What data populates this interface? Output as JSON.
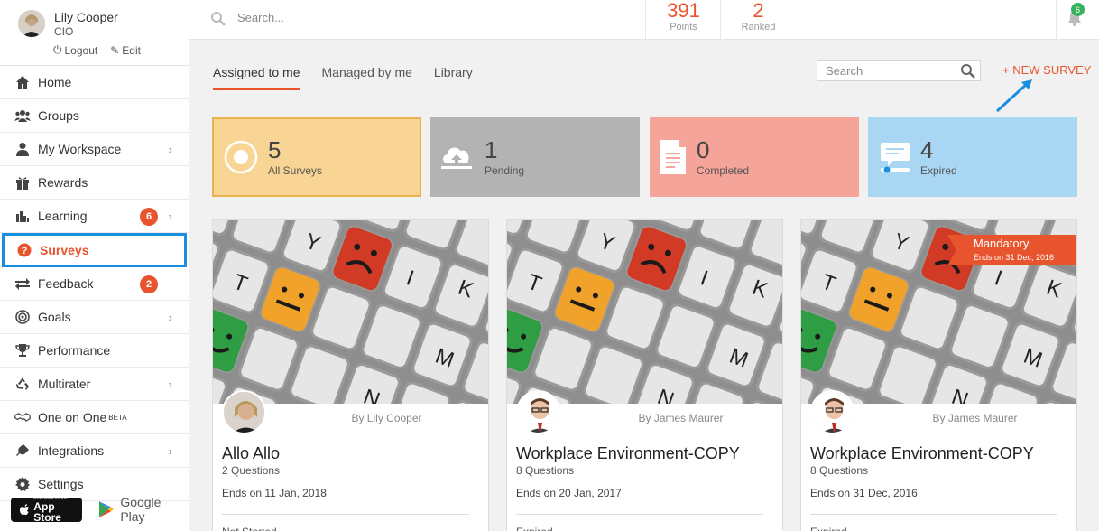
{
  "profile": {
    "name": "Lily Cooper",
    "role": "CIO",
    "logout": "Logout",
    "edit": "Edit"
  },
  "nav": [
    {
      "label": "Home",
      "icon": "home-icon"
    },
    {
      "label": "Groups",
      "icon": "groups-icon"
    },
    {
      "label": "My Workspace",
      "icon": "user-icon",
      "chevron": true
    },
    {
      "label": "Rewards",
      "icon": "gift-icon"
    },
    {
      "label": "Learning",
      "icon": "learning-icon",
      "badge": "6",
      "chevron": true
    },
    {
      "label": "Surveys",
      "icon": "question-icon",
      "active": true
    },
    {
      "label": "Feedback",
      "icon": "exchange-icon",
      "badge": "2"
    },
    {
      "label": "Goals",
      "icon": "target-icon",
      "chevron": true
    },
    {
      "label": "Performance",
      "icon": "trophy-icon"
    },
    {
      "label": "Multirater",
      "icon": "recycle-icon",
      "chevron": true
    },
    {
      "label": "One on One",
      "icon": "handshake-icon",
      "beta": "BETA"
    },
    {
      "label": "Integrations",
      "icon": "plug-icon",
      "chevron": true
    },
    {
      "label": "Settings",
      "icon": "gear-icon"
    }
  ],
  "stores": {
    "appstore_small": "Download on the",
    "appstore_big": "App Store",
    "gplay": "Google Play"
  },
  "topbar": {
    "search_placeholder": "Search...",
    "points": {
      "value": "391",
      "label": "Points"
    },
    "ranked": {
      "value": "2",
      "label": "Ranked"
    },
    "notifications": "6"
  },
  "tabs": [
    "Assigned to me",
    "Managed by me",
    "Library"
  ],
  "survey_search_placeholder": "Search",
  "new_survey": "+ NEW SURVEY",
  "tiles": [
    {
      "value": "5",
      "label": "All Surveys",
      "color": "#f8d595"
    },
    {
      "value": "1",
      "label": "Pending",
      "color": "#b3b3b3"
    },
    {
      "value": "0",
      "label": "Completed",
      "color": "#f4a498"
    },
    {
      "value": "4",
      "label": "Expired",
      "color": "#a9d7f3"
    }
  ],
  "cards": [
    {
      "by": "By Lily Cooper",
      "title": "Allo Allo",
      "questions": "2 Questions",
      "ends": "Ends on 11 Jan, 2018",
      "status": "Not Started"
    },
    {
      "by": "By James Maurer",
      "title": "Workplace Environment-COPY",
      "questions": "8 Questions",
      "ends": "Ends on 20 Jan, 2017",
      "status": "Expired"
    },
    {
      "by": "By James Maurer",
      "title": "Workplace Environment-COPY",
      "questions": "8 Questions",
      "ends": "Ends on 31 Dec, 2016",
      "status": "Expired",
      "mandatory": "Mandatory",
      "mandatory_ends": "Ends on 31 Dec, 2016"
    }
  ],
  "colors": {
    "accent": "#e8542e",
    "active_outline": "#1a8fe0",
    "bell_badge": "#35b25a"
  }
}
